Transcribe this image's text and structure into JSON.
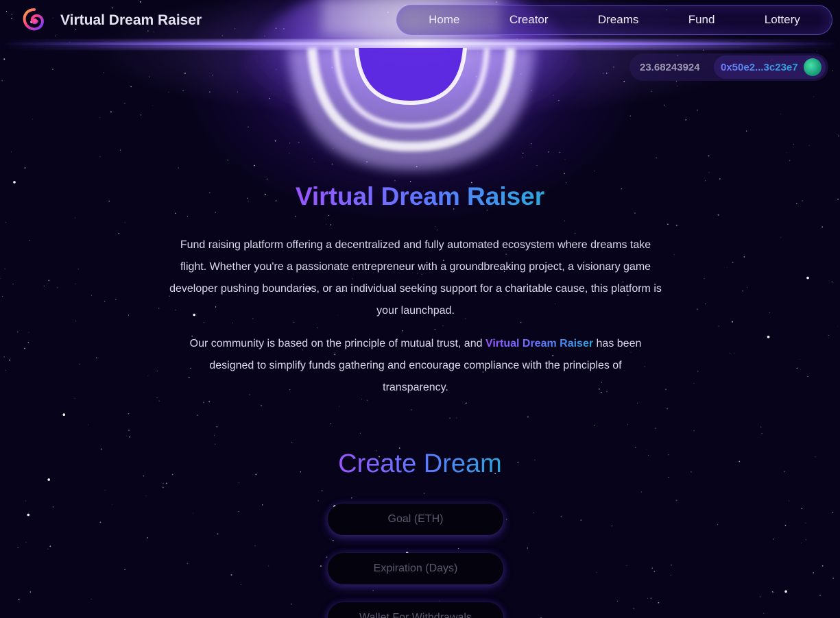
{
  "header": {
    "brand_name": "Virtual Dream Raiser",
    "logo_icon": "swirl-logo-icon",
    "nav": [
      "Home",
      "Creator",
      "Dreams",
      "Fund",
      "Lottery"
    ]
  },
  "wallet": {
    "balance": "23.68243924",
    "address": "0x50e2...3c23e7",
    "avatar_icon": "wallet-avatar-icon"
  },
  "hero": {
    "title": "Virtual Dream Raiser",
    "paragraph1": "Fund raising platform offering a decentralized and fully automated ecosystem where dreams take flight. Whether you're a passionate entrepreneur with a groundbreaking project, a visionary game developer pushing boundaries, or an individual seeking support for a charitable cause, this platform is your launchpad.",
    "paragraph2_before": "Our community is based on the principle of mutual trust, and ",
    "paragraph2_highlight": "Virtual Dream Raiser",
    "paragraph2_after": " has been designed to simplify funds gathering and encourage compliance with the principles of transparency."
  },
  "create": {
    "title": "Create Dream",
    "goal_placeholder": "Goal (ETH)",
    "expiration_placeholder": "Expiration (Days)",
    "wallet_placeholder": "Wallet For Withdrawals"
  },
  "colors": {
    "background": "#07031a",
    "gradient_start": "#9a55ff",
    "gradient_end": "#2aa8dc",
    "glow": "#7846ff"
  }
}
